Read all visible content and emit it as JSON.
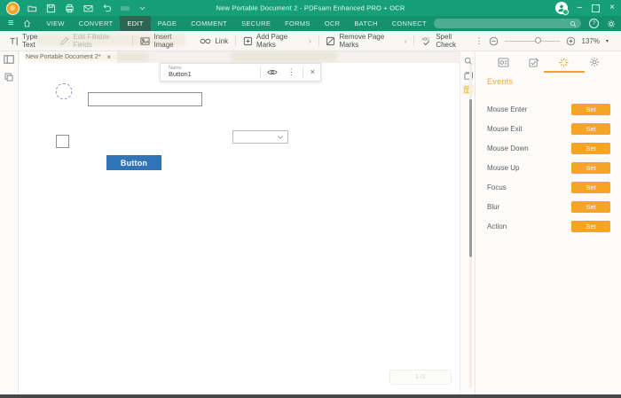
{
  "titlebar": {
    "title": "New Portable Document 2  -  PDFsam Enhanced PRO + OCR"
  },
  "menubar": {
    "items": [
      "VIEW",
      "CONVERT",
      "EDIT",
      "PAGE",
      "COMMENT",
      "SECURE",
      "FORMS",
      "OCR",
      "BATCH",
      "CONNECT"
    ],
    "active_item": "EDIT"
  },
  "toolbar": {
    "type_text": "Type Text",
    "edit_fields": "Edit Fillable Fields",
    "insert_image": "Insert Image",
    "link": "Link",
    "add_page_marks": "Add Page Marks",
    "remove_page_marks": "Remove Page Marks",
    "spell_check": "Spell Check",
    "zoom_level": "137%"
  },
  "document": {
    "tab_title": "New Portable Document 2*",
    "field_popup": {
      "name_label": "Name",
      "name_value": "Button1"
    },
    "page": {
      "button_label": "Button",
      "page_indicator": "1  /1"
    }
  },
  "events_panel": {
    "title": "Events",
    "events": [
      {
        "label": "Mouse Enter",
        "action": "Set"
      },
      {
        "label": "Mouse Exit",
        "action": "Set"
      },
      {
        "label": "Mouse Down",
        "action": "Set"
      },
      {
        "label": "Mouse Up",
        "action": "Set"
      },
      {
        "label": "Focus",
        "action": "Set"
      },
      {
        "label": "Blur",
        "action": "Set"
      },
      {
        "label": "Action",
        "action": "Set"
      }
    ]
  },
  "glyphs": {
    "hamburger": "≡",
    "minimize": "–",
    "close": "×",
    "help": "?",
    "submenu_arrow": "›",
    "overflow": "⋮",
    "dropdown_arrow": "▾",
    "tab_close": "×",
    "popup_close": "×"
  },
  "colors": {
    "titlebar_green": "#17a077",
    "menubar_green": "#13926b",
    "active_menu_green": "#2e6552",
    "accent_orange": "#f5a425",
    "button_blue": "#2e74b6"
  }
}
